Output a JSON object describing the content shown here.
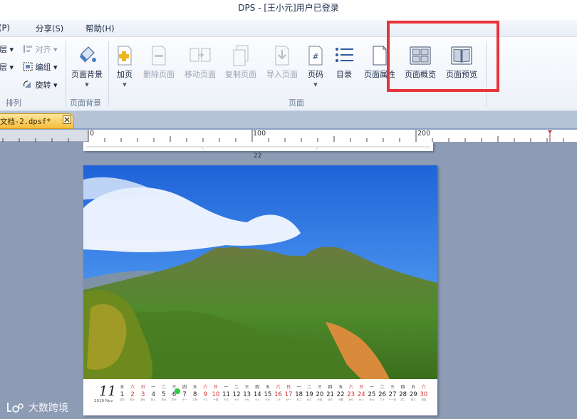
{
  "window": {
    "title": "DPS - [王小元]用户已登录"
  },
  "menu": [
    {
      "label": "(P)"
    },
    {
      "label": "分享(S)"
    },
    {
      "label": "帮助(H)"
    }
  ],
  "ribbon": {
    "arrange": {
      "layer1": "层",
      "layer2": "层",
      "align": "对齐",
      "group": "编组",
      "rotate": "旋转",
      "label": "排列"
    },
    "background": {
      "button": "页面背景",
      "label": "页面背景"
    },
    "page": {
      "buttons": [
        {
          "label": "加页",
          "icon": "add-page-icon",
          "enabled": true
        },
        {
          "label": "删除页面",
          "icon": "delete-page-icon",
          "enabled": false
        },
        {
          "label": "移动页面",
          "icon": "move-page-icon",
          "enabled": false
        },
        {
          "label": "复制页面",
          "icon": "copy-page-icon",
          "enabled": false
        },
        {
          "label": "导入页面",
          "icon": "import-page-icon",
          "enabled": false
        },
        {
          "label": "页码",
          "icon": "page-number-icon",
          "enabled": true
        },
        {
          "label": "目录",
          "icon": "toc-icon",
          "enabled": true
        },
        {
          "label": "页面属性",
          "icon": "page-properties-icon",
          "enabled": true
        },
        {
          "label": "页面概览",
          "icon": "page-overview-icon",
          "enabled": true
        },
        {
          "label": "页面预览",
          "icon": "page-preview-icon",
          "enabled": true
        }
      ],
      "label": "页面"
    },
    "highlight_color": "#e8333a"
  },
  "tab": {
    "label": "文档-2.dpsf*",
    "close_icon": "close-icon",
    "color": "#f5bd3c"
  },
  "ruler": {
    "labels": [
      "0",
      "100",
      "200"
    ]
  },
  "canvas": {
    "page_number": "22",
    "calendar": {
      "month": "11",
      "month_caption": "2019 Nov",
      "days": [
        {
          "w": "五",
          "d": "1",
          "l": "初五",
          "red": false
        },
        {
          "w": "六",
          "d": "2",
          "l": "初六",
          "red": true
        },
        {
          "w": "日",
          "d": "3",
          "l": "初七",
          "red": true
        },
        {
          "w": "一",
          "d": "4",
          "l": "初八",
          "red": false
        },
        {
          "w": "二",
          "d": "5",
          "l": "初九",
          "red": false
        },
        {
          "w": "三",
          "d": "6",
          "l": "初十",
          "red": false
        },
        {
          "w": "四",
          "d": "7",
          "l": "十一",
          "red": false
        },
        {
          "w": "五",
          "d": "8",
          "l": "立冬",
          "red": false
        },
        {
          "w": "六",
          "d": "9",
          "l": "十三",
          "red": true
        },
        {
          "w": "日",
          "d": "10",
          "l": "十四",
          "red": true
        },
        {
          "w": "一",
          "d": "11",
          "l": "十五",
          "red": false
        },
        {
          "w": "二",
          "d": "12",
          "l": "十六",
          "red": false
        },
        {
          "w": "三",
          "d": "13",
          "l": "十七",
          "red": false
        },
        {
          "w": "四",
          "d": "14",
          "l": "十八",
          "red": false
        },
        {
          "w": "五",
          "d": "15",
          "l": "十九",
          "red": false
        },
        {
          "w": "六",
          "d": "16",
          "l": "二十",
          "red": true
        },
        {
          "w": "日",
          "d": "17",
          "l": "廿一",
          "red": true
        },
        {
          "w": "一",
          "d": "18",
          "l": "廿二",
          "red": false
        },
        {
          "w": "二",
          "d": "19",
          "l": "廿三",
          "red": false
        },
        {
          "w": "三",
          "d": "20",
          "l": "廿四",
          "red": false
        },
        {
          "w": "四",
          "d": "21",
          "l": "廿五",
          "red": false
        },
        {
          "w": "五",
          "d": "22",
          "l": "小雪",
          "red": false
        },
        {
          "w": "六",
          "d": "23",
          "l": "廿七",
          "red": true
        },
        {
          "w": "日",
          "d": "24",
          "l": "廿八",
          "red": true
        },
        {
          "w": "一",
          "d": "25",
          "l": "廿九",
          "red": false
        },
        {
          "w": "二",
          "d": "26",
          "l": "三十",
          "red": false
        },
        {
          "w": "三",
          "d": "27",
          "l": "十一月",
          "red": false
        },
        {
          "w": "四",
          "d": "28",
          "l": "初二",
          "red": false
        },
        {
          "w": "五",
          "d": "29",
          "l": "初三",
          "red": false
        },
        {
          "w": "六",
          "d": "30",
          "l": "初四",
          "red": true
        }
      ]
    }
  },
  "watermark": {
    "text": "大数跨境",
    "icon": "logo-icon"
  }
}
